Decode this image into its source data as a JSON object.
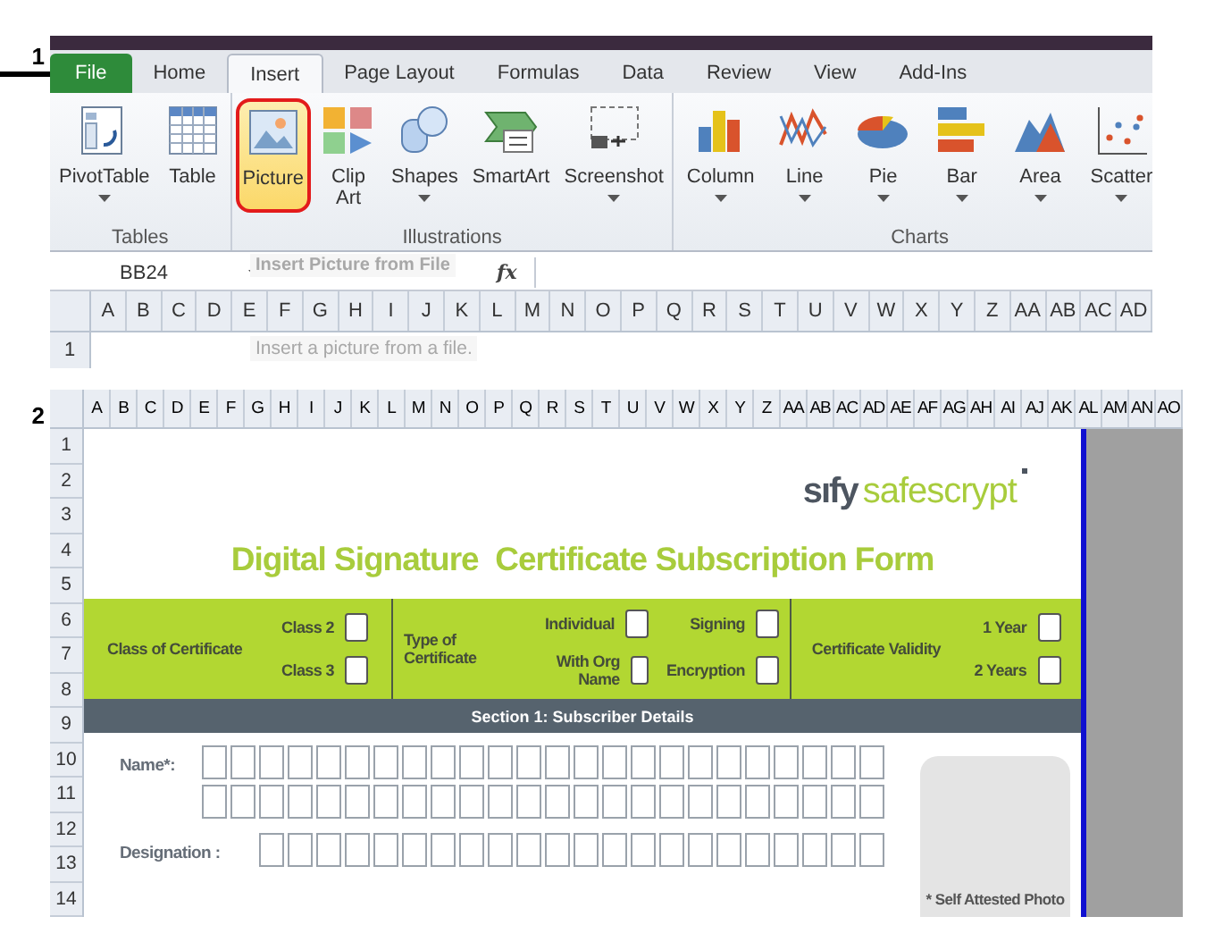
{
  "panel_labels": [
    "1",
    "2"
  ],
  "excel": {
    "tabs": [
      {
        "label": "File",
        "kind": "file",
        "selected": false
      },
      {
        "label": "Home",
        "kind": "tab",
        "selected": false
      },
      {
        "label": "Insert",
        "kind": "tab",
        "selected": true
      },
      {
        "label": "Page Layout",
        "kind": "tab",
        "selected": false
      },
      {
        "label": "Formulas",
        "kind": "tab",
        "selected": false
      },
      {
        "label": "Data",
        "kind": "tab",
        "selected": false
      },
      {
        "label": "Review",
        "kind": "tab",
        "selected": false
      },
      {
        "label": "View",
        "kind": "tab",
        "selected": false
      },
      {
        "label": "Add-Ins",
        "kind": "tab",
        "selected": false
      }
    ],
    "groups": [
      {
        "label": "Tables",
        "buttons": [
          {
            "label": "PivotTable",
            "kind": "pivot",
            "dropdown": true,
            "highlighted": false
          },
          {
            "label": "Table",
            "kind": "table",
            "dropdown": false,
            "highlighted": false
          }
        ]
      },
      {
        "label": "Illustrations",
        "buttons": [
          {
            "label": "Picture",
            "kind": "picture",
            "dropdown": false,
            "highlighted": true
          },
          {
            "label": "Clip Art",
            "kind": "clipart",
            "dropdown": false,
            "highlighted": false
          },
          {
            "label": "Shapes",
            "kind": "shapes",
            "dropdown": true,
            "highlighted": false
          },
          {
            "label": "SmartArt",
            "kind": "smartart",
            "dropdown": false,
            "highlighted": false
          },
          {
            "label": "Screenshot",
            "kind": "screenshot",
            "dropdown": true,
            "highlighted": false
          }
        ]
      },
      {
        "label": "Charts",
        "buttons": [
          {
            "label": "Column",
            "kind": "column",
            "dropdown": true,
            "highlighted": false
          },
          {
            "label": "Line",
            "kind": "line",
            "dropdown": true,
            "highlighted": false
          },
          {
            "label": "Pie",
            "kind": "pie",
            "dropdown": true,
            "highlighted": false
          },
          {
            "label": "Bar",
            "kind": "bar",
            "dropdown": true,
            "highlighted": false
          },
          {
            "label": "Area",
            "kind": "area",
            "dropdown": true,
            "highlighted": false
          },
          {
            "label": "Scatter",
            "kind": "scatter",
            "dropdown": true,
            "highlighted": false
          }
        ]
      }
    ],
    "name_box": "BB24",
    "formula_icon": "fx",
    "tooltip": {
      "title": "Insert Picture from File",
      "text": "Insert a picture from a file."
    },
    "columns": [
      "A",
      "B",
      "C",
      "D",
      "E",
      "F",
      "G",
      "H",
      "I",
      "J",
      "K",
      "L",
      "M",
      "N",
      "O",
      "P",
      "Q",
      "R",
      "S",
      "T",
      "U",
      "V",
      "W",
      "X",
      "Y",
      "Z",
      "AA",
      "AB",
      "AC",
      "AD"
    ],
    "rows": [
      "1"
    ]
  },
  "sheet": {
    "columns": [
      "A",
      "B",
      "C",
      "D",
      "E",
      "F",
      "G",
      "H",
      "I",
      "J",
      "K",
      "L",
      "M",
      "N",
      "O",
      "P",
      "Q",
      "R",
      "S",
      "T",
      "U",
      "V",
      "W",
      "X",
      "Y",
      "Z",
      "AA",
      "AB",
      "AC",
      "AD",
      "AE",
      "AF",
      "AG",
      "AH",
      "AI",
      "AJ",
      "AK",
      "AL",
      "AM",
      "AN",
      "AO"
    ],
    "rows": [
      "1",
      "2",
      "3",
      "4",
      "5",
      "6",
      "7",
      "8",
      "9",
      "10",
      "11",
      "12",
      "13",
      "14"
    ],
    "form": {
      "logo": {
        "brand": "sıfy",
        "product": "safescrypt"
      },
      "title": "Digital Signature  Certificate Subscription Form",
      "options": [
        {
          "label": "Class of Certificate",
          "choices": [
            {
              "label": "Class 2",
              "checked": false
            },
            {
              "label": "Class 3",
              "checked": false
            }
          ]
        },
        {
          "label": "Type of Certificate",
          "choices": [
            {
              "label": "Individual",
              "checked": false
            },
            {
              "label": "Signing",
              "checked": false
            },
            {
              "label": "With Org Name",
              "checked": false
            },
            {
              "label": "Encryption",
              "checked": false
            }
          ]
        },
        {
          "label": "Certificate Validity",
          "choices": [
            {
              "label": "1 Year",
              "checked": false
            },
            {
              "label": "2 Years",
              "checked": false
            }
          ]
        }
      ],
      "section": "Section 1: Subscriber Details",
      "fields": [
        {
          "label": "Name*:",
          "kind": "double"
        },
        {
          "label": "Designation :",
          "kind": "single"
        }
      ],
      "photo_caption": "* Self Attested Photo"
    }
  }
}
